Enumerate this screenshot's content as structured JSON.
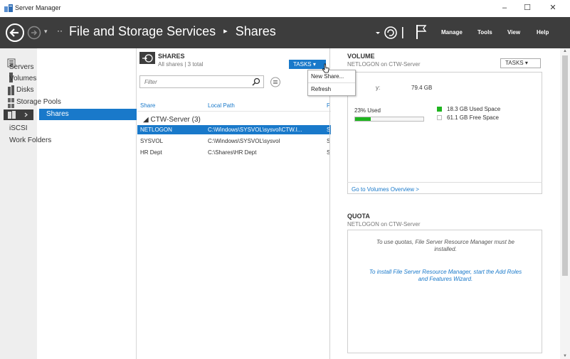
{
  "window": {
    "title": "Server Manager",
    "minimize": "–",
    "maximize": "☐",
    "close": "✕"
  },
  "header": {
    "breadcrumb_prefix": "··",
    "breadcrumb": [
      "File and Storage Services",
      "Shares"
    ],
    "separator": "▸",
    "menu": [
      "Manage",
      "Tools",
      "View",
      "Help"
    ],
    "nav_dropdown": "▾"
  },
  "left_icons": [
    "dashboard-icon",
    "local-server-icon",
    "all-servers-icon",
    "roles-icon",
    "file-storage-icon"
  ],
  "nav": {
    "items": [
      {
        "label": "Servers",
        "sub": false,
        "selected": false
      },
      {
        "label": "Volumes",
        "sub": false,
        "selected": false
      },
      {
        "label": "Disks",
        "sub": true,
        "selected": false
      },
      {
        "label": "Storage Pools",
        "sub": true,
        "selected": false
      },
      {
        "label": "Shares",
        "sub": false,
        "selected": true
      },
      {
        "label": "iSCSI",
        "sub": false,
        "selected": false
      },
      {
        "label": "Work Folders",
        "sub": false,
        "selected": false
      }
    ]
  },
  "shares": {
    "title": "SHARES",
    "subtitle": "All shares | 3 total",
    "tasks_label": "TASKS  ▾",
    "filter_placeholder": "Filter",
    "columns": [
      "Share",
      "Local Path",
      "P"
    ],
    "group": "◢  CTW-Server (3)",
    "rows": [
      {
        "share": "NETLOGON",
        "path": "C:\\Windows\\SYSVOL\\sysvol\\CTW.I...",
        "proto": "S",
        "selected": true
      },
      {
        "share": "SYSVOL",
        "path": "C:\\Windows\\SYSVOL\\sysvol",
        "proto": "S",
        "selected": false
      },
      {
        "share": "HR Dept",
        "path": "C:\\Shares\\HR Dept",
        "proto": "S",
        "selected": false
      }
    ],
    "tasks_menu": [
      "New Share...",
      "Refresh"
    ]
  },
  "volume": {
    "title": "VOLUME",
    "subtitle": "NETLOGON on CTW-Server",
    "tasks_label": "TASKS  ▾",
    "capacity_label": "y:",
    "capacity_value": "79.4 GB",
    "used_percent_label": "23% Used",
    "used_fraction": 0.23,
    "used_color": "#1fb51f",
    "legend": [
      {
        "label": "18.3 GB Used Space",
        "color": "#1fb51f"
      },
      {
        "label": "61.1 GB Free Space",
        "color": "#ffffff"
      }
    ],
    "overview_link": "Go to Volumes Overview >"
  },
  "quota": {
    "title": "QUOTA",
    "subtitle": "NETLOGON on CTW-Server",
    "message_line1": "To use quotas, File Server Resource Manager must be",
    "message_line2": "installed.",
    "link_line1": "To install File Server Resource Manager, start the Add Roles",
    "link_line2": "and Features Wizard."
  },
  "colors": {
    "header_bg": "#3d3d3d",
    "accent": "#1979ca",
    "sidebar_bg": "#eeeeee"
  }
}
